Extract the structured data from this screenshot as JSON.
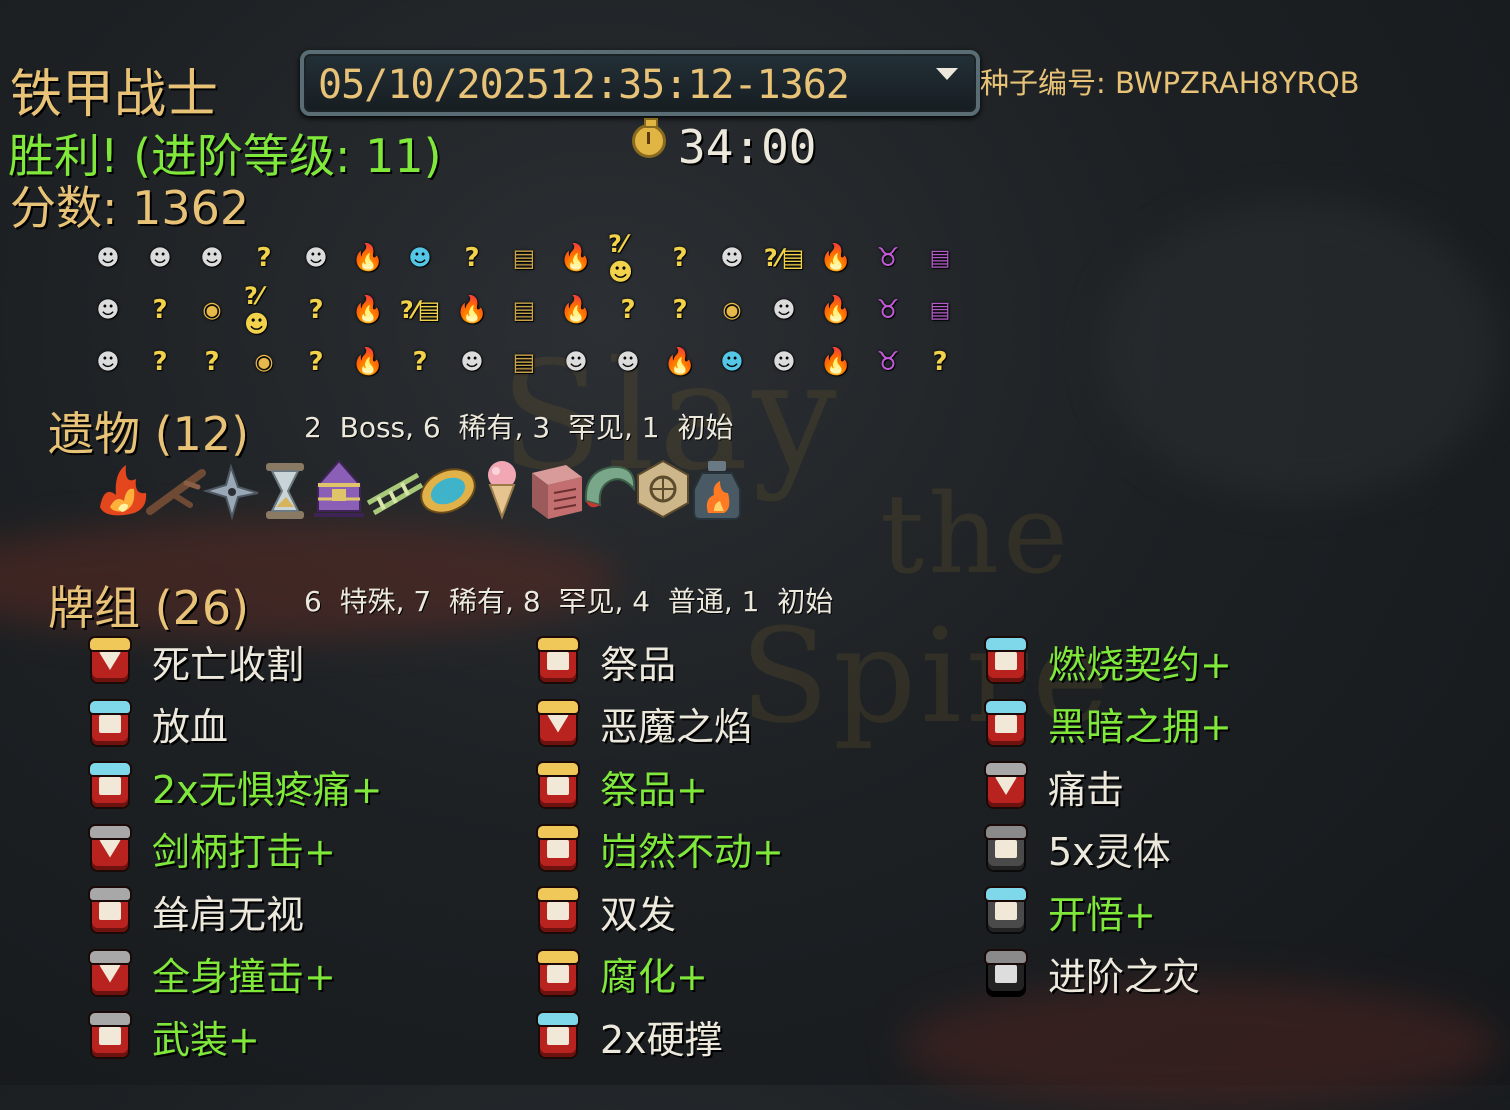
{
  "character": {
    "title": "铁甲战士"
  },
  "run_selector": {
    "value": "05/10/202512:35:12-1362"
  },
  "seed": {
    "text": "种子编号: BWPZRAH8YRQB"
  },
  "result": {
    "victory_text": "胜利! (进阶等级: 11)"
  },
  "timer": {
    "text": "34:00"
  },
  "score": {
    "text": "分数: 1362"
  },
  "map": {
    "rows": [
      [
        "monster",
        "monster",
        "monster",
        "unknown",
        "monster",
        "rest",
        "elite",
        "unknown",
        "treasure",
        "rest",
        "unknown-monster",
        "unknown",
        "monster",
        "unknown-treasure",
        "rest",
        "boss",
        "chest"
      ],
      [
        "monster",
        "unknown",
        "shop",
        "unknown-monster",
        "unknown",
        "rest",
        "unknown-treasure",
        "rest",
        "treasure",
        "rest",
        "unknown",
        "unknown",
        "shop",
        "monster",
        "rest",
        "boss",
        "chest"
      ],
      [
        "monster",
        "unknown",
        "unknown",
        "shop",
        "unknown",
        "rest",
        "unknown",
        "monster",
        "treasure",
        "monster",
        "monster",
        "rest",
        "elite",
        "monster",
        "rest",
        "boss",
        "unknown"
      ]
    ]
  },
  "relics": {
    "title": "遗物 (12)",
    "summary": "2  Boss, 6  稀有, 3  罕见, 1  初始",
    "items": [
      {
        "icon": "burning-blood-icon"
      },
      {
        "icon": "twig-icon"
      },
      {
        "icon": "shuriken-icon"
      },
      {
        "icon": "hourglass-icon"
      },
      {
        "icon": "tent-icon"
      },
      {
        "icon": "ladder-icon"
      },
      {
        "icon": "disc-icon"
      },
      {
        "icon": "ice-cream-icon"
      },
      {
        "icon": "cube-icon"
      },
      {
        "icon": "horn-icon"
      },
      {
        "icon": "stone-calendar-icon"
      },
      {
        "icon": "bottled-flame-icon"
      }
    ]
  },
  "deck": {
    "title": "牌组 (26)",
    "summary": "6  特殊, 7  稀有, 8  罕见, 4  普通, 1  初始",
    "columns": [
      [
        {
          "name": "死亡收割",
          "upgraded": false,
          "type": "attack",
          "rarity": "rare"
        },
        {
          "name": "放血",
          "upgraded": false,
          "type": "skill",
          "rarity": "uncommon"
        },
        {
          "name": "2x无惧疼痛+",
          "upgraded": true,
          "type": "power",
          "rarity": "uncommon"
        },
        {
          "name": "剑柄打击+",
          "upgraded": true,
          "type": "attack",
          "rarity": "common"
        },
        {
          "name": "耸肩无视",
          "upgraded": false,
          "type": "skill",
          "rarity": "common"
        },
        {
          "name": "全身撞击+",
          "upgraded": true,
          "type": "attack",
          "rarity": "common"
        },
        {
          "name": "武装+",
          "upgraded": true,
          "type": "skill",
          "rarity": "common"
        }
      ],
      [
        {
          "name": "祭品",
          "upgraded": false,
          "type": "skill",
          "rarity": "rare"
        },
        {
          "name": "恶魔之焰",
          "upgraded": false,
          "type": "attack",
          "rarity": "rare"
        },
        {
          "name": "祭品+",
          "upgraded": true,
          "type": "skill",
          "rarity": "rare"
        },
        {
          "name": "岿然不动+",
          "upgraded": true,
          "type": "skill",
          "rarity": "rare"
        },
        {
          "name": "双发",
          "upgraded": false,
          "type": "skill",
          "rarity": "rare"
        },
        {
          "name": "腐化+",
          "upgraded": true,
          "type": "power",
          "rarity": "rare"
        },
        {
          "name": "2x硬撑",
          "upgraded": false,
          "type": "skill",
          "rarity": "uncommon"
        }
      ],
      [
        {
          "name": "燃烧契约+",
          "upgraded": true,
          "type": "skill",
          "rarity": "uncommon"
        },
        {
          "name": "黑暗之拥+",
          "upgraded": true,
          "type": "power",
          "rarity": "uncommon"
        },
        {
          "name": "痛击",
          "upgraded": false,
          "type": "attack",
          "rarity": "basic"
        },
        {
          "name": "5x灵体",
          "upgraded": false,
          "type": "skill",
          "rarity": "special",
          "color": "colorless"
        },
        {
          "name": "开悟+",
          "upgraded": true,
          "type": "skill",
          "rarity": "uncommon",
          "color": "colorless"
        },
        {
          "name": "进阶之灾",
          "upgraded": false,
          "type": "curse",
          "rarity": "special",
          "color": "curse"
        }
      ]
    ]
  },
  "colors": {
    "gold": "#e8c377",
    "upgraded_green": "#7fe83a",
    "white": "#ece8dc",
    "rarity_rare": "#f0c85a",
    "rarity_uncommon": "#7fd8ea",
    "rarity_common": "#a8a8a8",
    "rarity_special": "#8a8a8a"
  }
}
